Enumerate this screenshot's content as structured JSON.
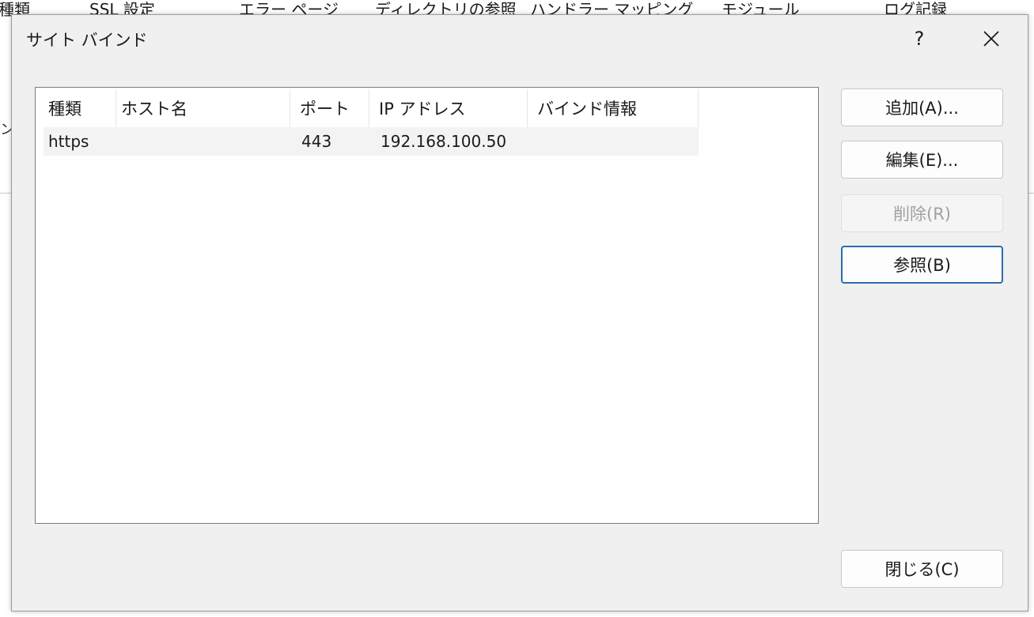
{
  "background": {
    "feature_labels": [
      "種類",
      "SSL 設定",
      "エラー ページ",
      "ディレクトリの参照",
      "ハンドラー マッピング",
      "モジュール",
      "ログ記録"
    ],
    "side_fragment": "ン"
  },
  "dialog": {
    "title": "サイト バインド",
    "help_glyph": "?",
    "columns": [
      "種類",
      "ホスト名",
      "ポート",
      "IP アドレス",
      "バインド情報"
    ],
    "rows": [
      {
        "type": "https",
        "host": "",
        "port": "443",
        "ip": "192.168.100.50",
        "binding": ""
      }
    ],
    "buttons": {
      "add": "追加(A)...",
      "edit": "編集(E)...",
      "remove": "削除(R)",
      "browse": "参照(B)",
      "close": "閉じる(C)"
    }
  },
  "colors": {
    "dialog_bg": "#f0f0f0",
    "default_button_border": "#2b6cb0",
    "disabled_text": "#a0a0a0"
  }
}
